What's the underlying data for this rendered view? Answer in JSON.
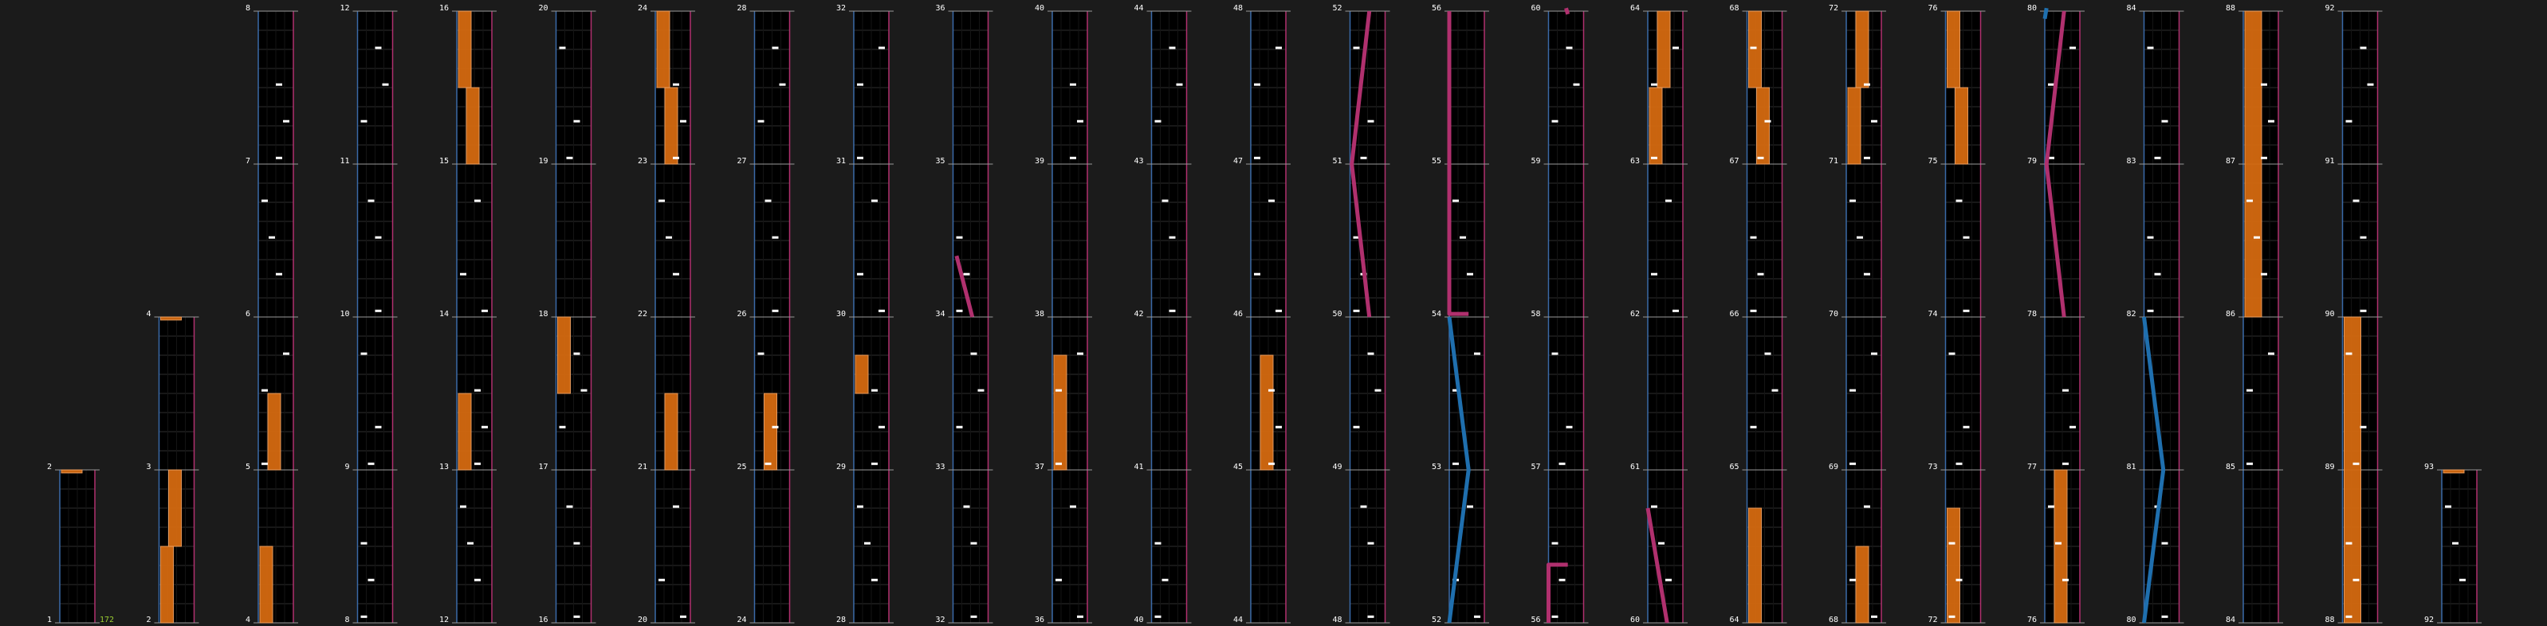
{
  "colors": {
    "background": "#1b1b1b",
    "lane_bg": "#000000",
    "grid": "#2e2e2e",
    "measure_line": "#9a9a9a",
    "left_border": "#3a6aa8",
    "right_border": "#b0306e",
    "hold": "#d46a10",
    "slide_pink": "#b0306e",
    "slide_blue": "#1f6fae",
    "tap": "#ffffff",
    "combo": "#9acd32",
    "label": "#ffffff"
  },
  "chart": {
    "combo_count": "172",
    "columns": [
      {
        "top_beat": "2",
        "labels": [
          "1",
          "2"
        ]
      },
      {
        "top_beat": "4",
        "labels": [
          "2",
          "3",
          "4"
        ]
      },
      {
        "top_beat": "8",
        "labels": [
          "4",
          "5",
          "6",
          "7",
          "8"
        ]
      },
      {
        "top_beat": "12",
        "labels": [
          "8",
          "9",
          "10",
          "11",
          "12"
        ]
      },
      {
        "top_beat": "16",
        "labels": [
          "12",
          "13",
          "14",
          "15",
          "16"
        ]
      },
      {
        "top_beat": "20",
        "labels": [
          "16",
          "17",
          "18",
          "19",
          "20"
        ]
      },
      {
        "top_beat": "24",
        "labels": [
          "20",
          "21",
          "22",
          "23",
          "24"
        ]
      },
      {
        "top_beat": "28",
        "labels": [
          "24",
          "25",
          "26",
          "27",
          "28"
        ]
      },
      {
        "top_beat": "32",
        "labels": [
          "28",
          "29",
          "30",
          "31",
          "32"
        ]
      },
      {
        "top_beat": "36",
        "labels": [
          "32",
          "33",
          "34",
          "35",
          "36"
        ]
      },
      {
        "top_beat": "40",
        "labels": [
          "36",
          "37",
          "38",
          "39",
          "40"
        ]
      },
      {
        "top_beat": "44",
        "labels": [
          "40",
          "41",
          "42",
          "43",
          "44"
        ]
      },
      {
        "top_beat": "48",
        "labels": [
          "44",
          "45",
          "46",
          "47",
          "48"
        ]
      },
      {
        "top_beat": "52",
        "labels": [
          "48",
          "49",
          "50",
          "51",
          "52"
        ]
      },
      {
        "top_beat": "56",
        "labels": [
          "52",
          "53",
          "54",
          "55",
          "56"
        ]
      },
      {
        "top_beat": "60",
        "labels": [
          "56",
          "57",
          "58",
          "59",
          "60"
        ]
      },
      {
        "top_beat": "64",
        "labels": [
          "60",
          "61",
          "62",
          "63",
          "64"
        ]
      },
      {
        "top_beat": "68",
        "labels": [
          "64",
          "65",
          "66",
          "67",
          "68"
        ]
      },
      {
        "top_beat": "72",
        "labels": [
          "68",
          "69",
          "70",
          "71",
          "72"
        ]
      },
      {
        "top_beat": "76",
        "labels": [
          "72",
          "73",
          "74",
          "75",
          "76"
        ]
      },
      {
        "top_beat": "80",
        "labels": [
          "76",
          "77",
          "78",
          "79",
          "80"
        ]
      },
      {
        "top_beat": "84",
        "labels": [
          "80",
          "81",
          "82",
          "83",
          "84"
        ]
      },
      {
        "top_beat": "88",
        "labels": [
          "84",
          "85",
          "86",
          "87",
          "88"
        ]
      },
      {
        "top_beat": "92",
        "labels": [
          "88",
          "89",
          "90",
          "91",
          "92"
        ]
      },
      {
        "top_beat": "93",
        "labels": [
          "92",
          "93"
        ]
      }
    ]
  }
}
